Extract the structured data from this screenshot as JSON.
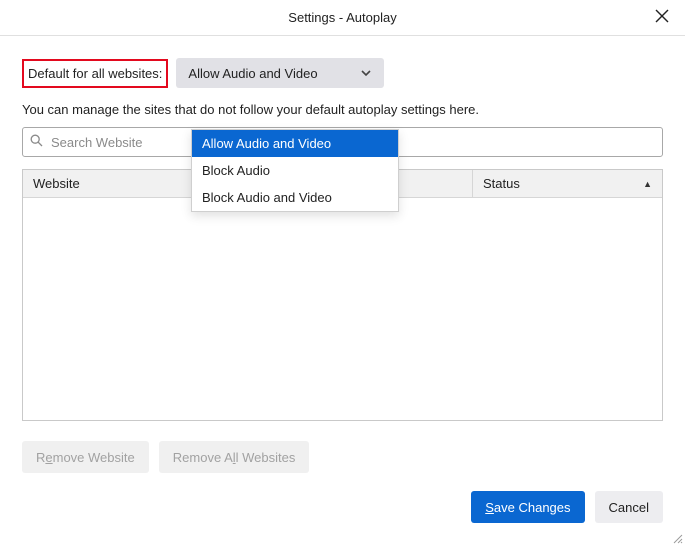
{
  "header": {
    "title": "Settings - Autoplay"
  },
  "default_row": {
    "label": "Default for all websites:",
    "selected": "Allow Audio and Video",
    "options": [
      "Allow Audio and Video",
      "Block Audio",
      "Block Audio and Video"
    ]
  },
  "description": "You can manage the sites that do not follow your default autoplay settings here.",
  "search": {
    "placeholder": "Search Website"
  },
  "table": {
    "columns": {
      "website": "Website",
      "status": "Status"
    },
    "sort": {
      "column": "status",
      "direction": "asc"
    },
    "rows": []
  },
  "buttons": {
    "remove_one": {
      "prefix": "R",
      "accel": "e",
      "suffix": "move Website"
    },
    "remove_all": {
      "prefix": "Remove A",
      "accel": "l",
      "suffix": "l Websites"
    },
    "save": {
      "prefix": "",
      "accel": "S",
      "suffix": "ave Changes"
    },
    "cancel": "Cancel"
  }
}
